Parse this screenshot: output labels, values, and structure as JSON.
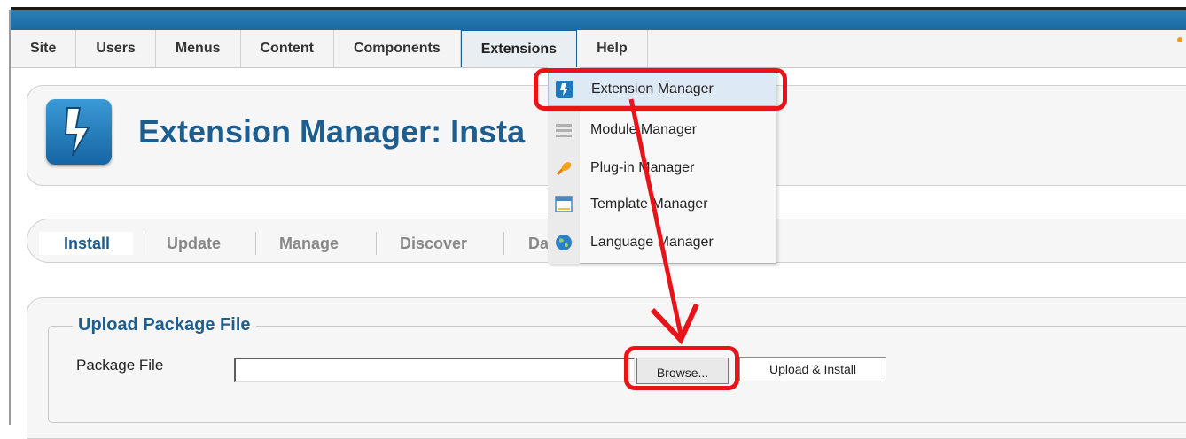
{
  "menu": {
    "items": [
      {
        "label": "Site"
      },
      {
        "label": "Users"
      },
      {
        "label": "Menus"
      },
      {
        "label": "Content"
      },
      {
        "label": "Components"
      },
      {
        "label": "Extensions"
      },
      {
        "label": "Help"
      }
    ],
    "active": "Extensions"
  },
  "header": {
    "title": "Extension Manager: Insta"
  },
  "tabs": {
    "install": "Install",
    "update": "Update",
    "manage": "Manage",
    "discover": "Discover",
    "partial": "Da"
  },
  "dropdown": {
    "items": [
      {
        "label": "Extension Manager",
        "icon": "lightning-icon"
      },
      {
        "label": "Module Manager",
        "icon": "module-icon"
      },
      {
        "label": "Plug-in Manager",
        "icon": "plugin-icon"
      },
      {
        "label": "Template Manager",
        "icon": "template-icon"
      },
      {
        "label": "Language Manager",
        "icon": "globe-icon"
      }
    ]
  },
  "upload": {
    "legend": "Upload Package File",
    "field_label": "Package File",
    "file_value": "",
    "browse_label": "Browse...",
    "submit_label": "Upload & Install"
  },
  "colors": {
    "accent": "#1d5e8f",
    "annotation": "#e8141a",
    "topbar": "#2b80b8"
  }
}
